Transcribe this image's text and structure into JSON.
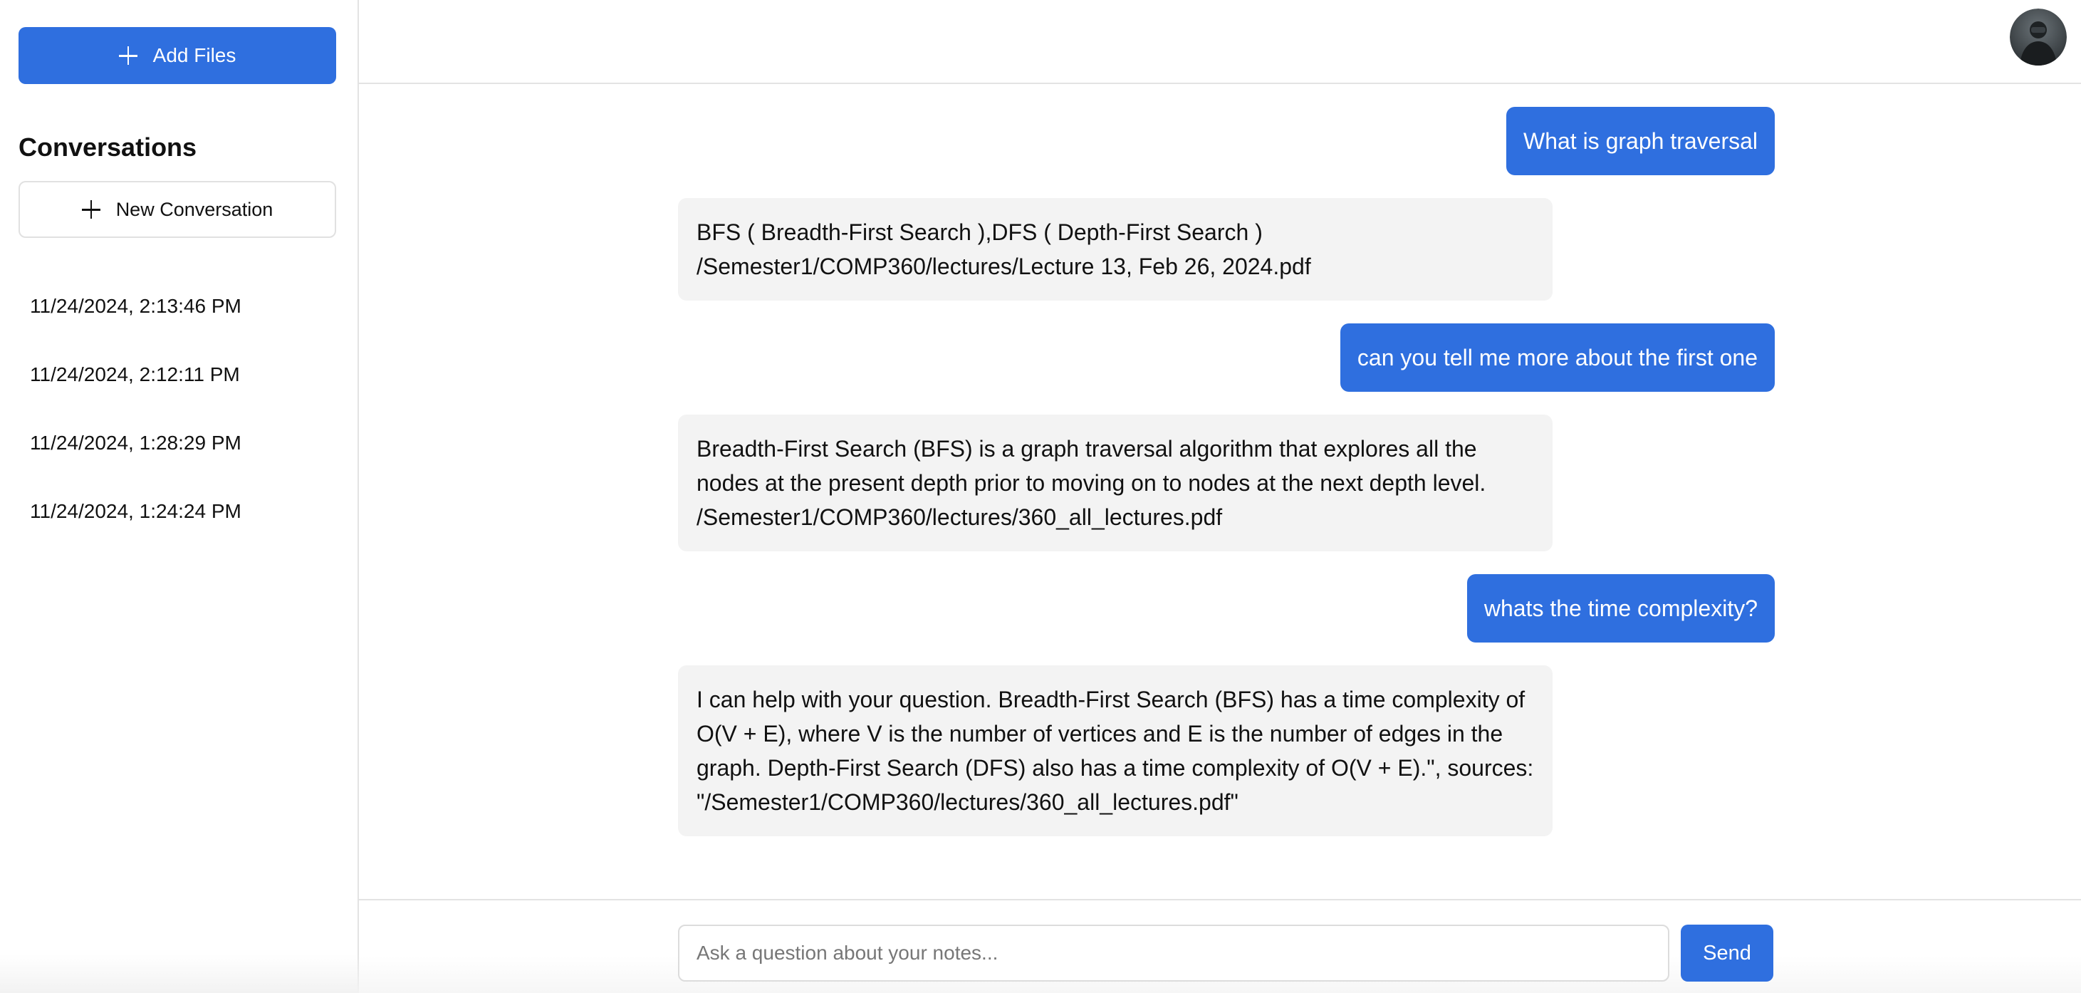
{
  "sidebar": {
    "add_files_label": "Add Files",
    "conversations_heading": "Conversations",
    "new_conversation_label": "New Conversation",
    "conversations": [
      {
        "label": "11/24/2024, 2:13:46 PM"
      },
      {
        "label": "11/24/2024, 2:12:11 PM"
      },
      {
        "label": "11/24/2024, 1:28:29 PM"
      },
      {
        "label": "11/24/2024, 1:24:24 PM"
      }
    ]
  },
  "header": {
    "avatar_icon": "user-avatar"
  },
  "chat": {
    "messages": [
      {
        "role": "user",
        "text": "What is graph traversal"
      },
      {
        "role": "assistant",
        "lines": [
          "BFS ( Breadth-First Search ),DFS ( Depth-First Search )",
          "/Semester1/COMP360/lectures/Lecture 13, Feb 26, 2024.pdf"
        ]
      },
      {
        "role": "user",
        "text": "can you tell me more about the first one"
      },
      {
        "role": "assistant",
        "lines": [
          "Breadth-First Search (BFS) is a graph traversal algorithm that explores all the",
          "nodes at the present depth prior to moving on to nodes at the next depth level.",
          "/Semester1/COMP360/lectures/360_all_lectures.pdf"
        ]
      },
      {
        "role": "user",
        "text": "whats the time complexity?"
      },
      {
        "role": "assistant",
        "lines": [
          "I can help with your question. Breadth-First Search (BFS) has a time complexity of",
          "O(V + E), where V is the number of vertices and E is the number of edges in the",
          "graph. Depth-First Search (DFS) also has a time complexity of O(V + E).\", sources:",
          "\"/Semester1/COMP360/lectures/360_all_lectures.pdf\""
        ]
      }
    ]
  },
  "composer": {
    "value": "",
    "placeholder": "Ask a question about your notes...",
    "send_label": "Send"
  },
  "colors": {
    "accent": "#2f6fdf",
    "assistant_bubble": "#f3f3f3",
    "border": "#e3e3e3"
  }
}
